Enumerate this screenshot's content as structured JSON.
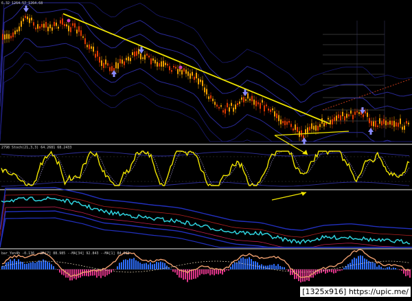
{
  "price_pane": {
    "label": "6.32 1264.57 1264.68"
  },
  "stoch_pane": {
    "label": "2798 Stoch(21,3,3) 64.2681 68.2433"
  },
  "bar_pane": {
    "label": "bar_Yen4h -0.136 --MA[7] 88.985 --MA[34] 92.843 --MA[1] 84.935"
  },
  "watermark": "[1325x916] https://upic.me/",
  "colors": {
    "background": "#000000",
    "candle_up": "#f0a000",
    "candle_down": "#e03a00",
    "bands": "#2a2a9a",
    "trendline": "#f2e600",
    "stoch": "#f2e600",
    "signal_arrow": "#8a8cff",
    "divergence_arrow": "#f2e600",
    "cyan_line": "#2fd4e0",
    "histogram_up": "#2e6fff",
    "histogram_down": "#e0358a",
    "ma_line": "#f0a070",
    "level_line": "#6a6a6a",
    "fib_line": "#c03a1a"
  },
  "icons": [
    "up-arrow-icon",
    "down-arrow-icon"
  ]
}
